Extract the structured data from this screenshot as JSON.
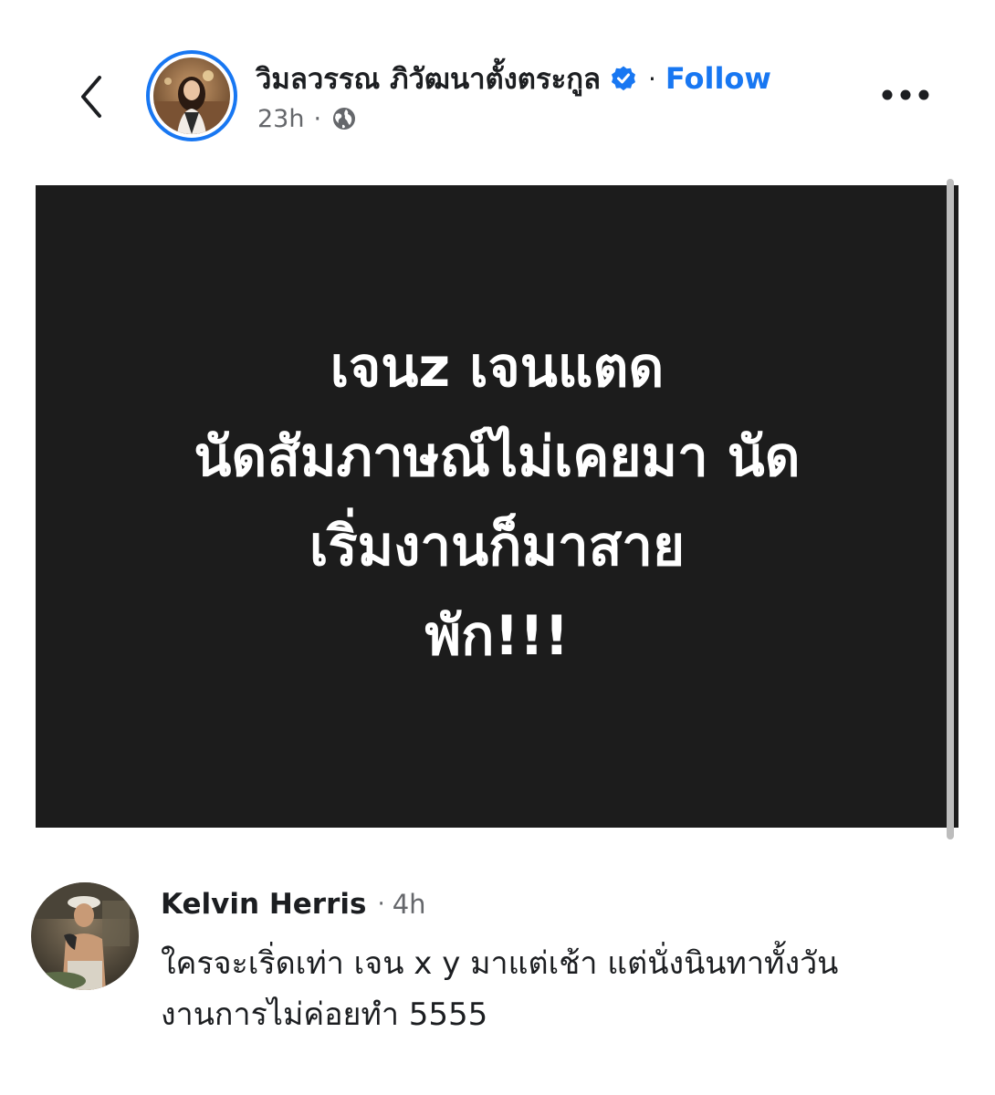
{
  "header": {
    "author_name": "วิมลวรรณ ภิวัฒนาตั้งตระกูล",
    "separator": "·",
    "follow_label": "Follow",
    "post_time": "23h",
    "meta_separator": "·",
    "privacy_icon": "globe-icon",
    "verified_icon": "verified-badge-icon",
    "back_icon": "chevron-left-icon",
    "more_icon": "more-options-icon",
    "accent_color": "#1877f2"
  },
  "post_image": {
    "background_color": "#1c1c1c",
    "lines": [
      "เจนz เจนแตด",
      "นัดสัมภาษณ์ไม่เคยมา นัด",
      "เริ่มงานก็มาสาย",
      "พัก!!!"
    ]
  },
  "comment": {
    "name": "Kelvin Herris",
    "separator": "·",
    "time": "4h",
    "lines": [
      "ใครจะเริ่ดเท่า เจน x y มาแต่เช้า แต่นั่งนินทาทั้งวัน",
      "งานการไม่ค่อยทำ 5555"
    ]
  }
}
